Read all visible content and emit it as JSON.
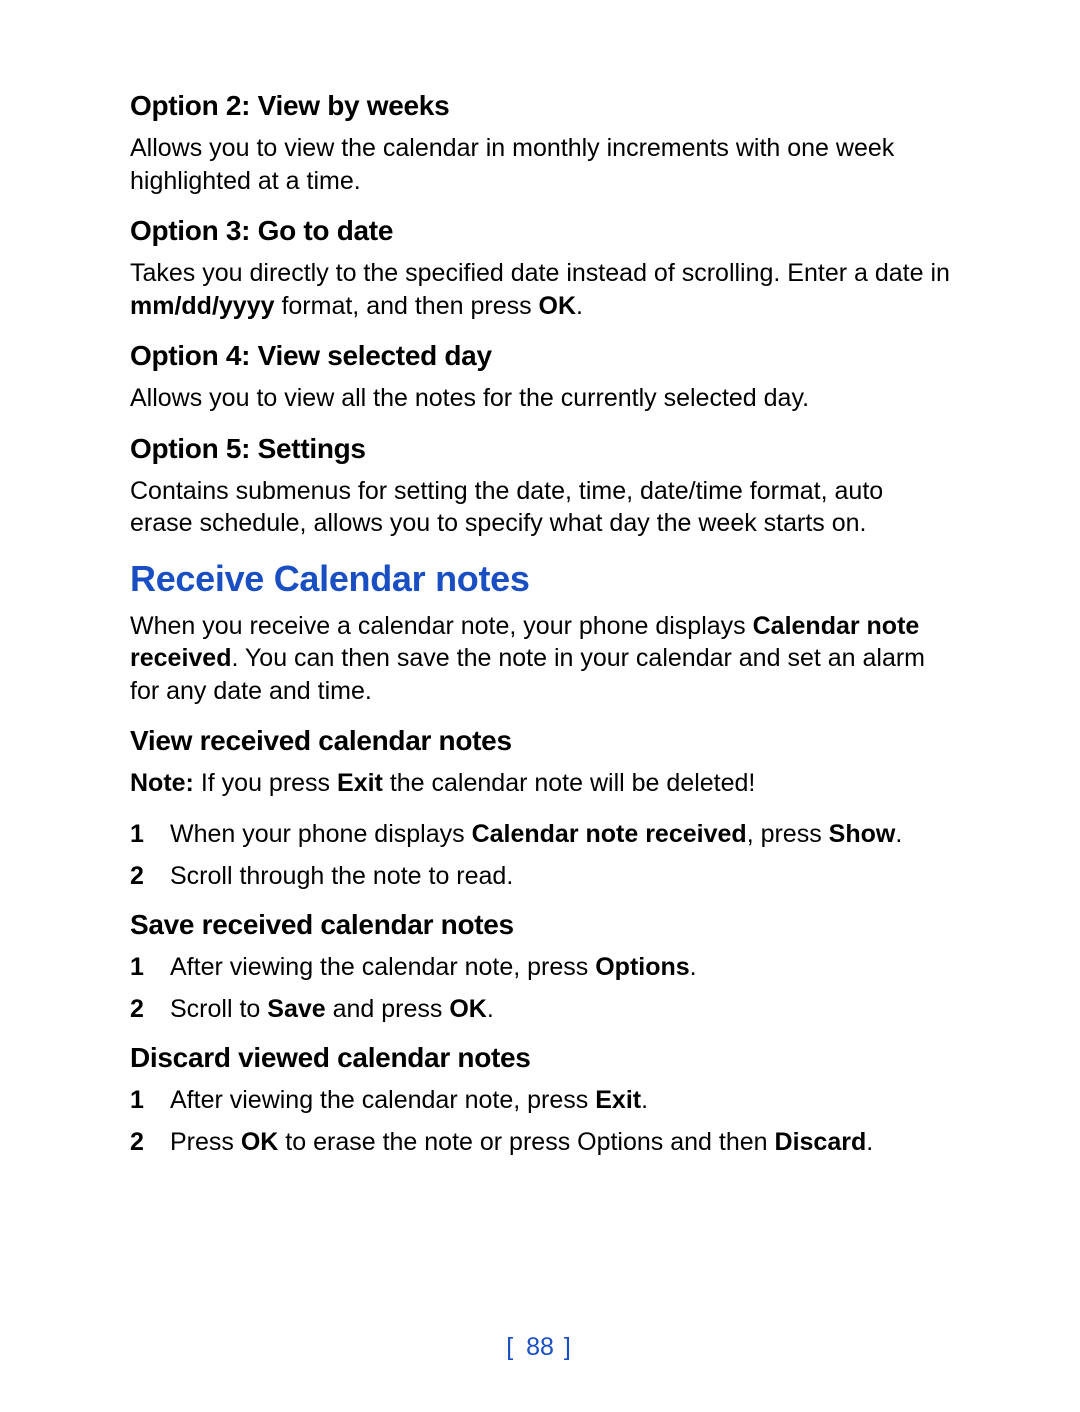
{
  "option2": {
    "heading": "Option 2: View by weeks",
    "body": "Allows you to view the calendar in monthly increments with one week highlighted at a time."
  },
  "option3": {
    "heading": "Option 3: Go to date",
    "body_pre": "Takes you directly to the specified date instead of scrolling. Enter a date in ",
    "body_bold1": "mm/dd/yyyy",
    "body_mid": " format, and then press ",
    "body_bold2": "OK",
    "body_post": "."
  },
  "option4": {
    "heading": "Option 4: View selected day",
    "body": "Allows you to view all the notes for the currently selected day."
  },
  "option5": {
    "heading": "Option 5: Settings",
    "body": "Contains submenus for setting the date, time, date/time format, auto erase schedule, allows you to specify what day the week starts on."
  },
  "receive": {
    "heading": "Receive Calendar notes",
    "body_pre": "When you receive a calendar note, your phone displays ",
    "body_bold1": "Calendar note received",
    "body_post": ". You can then save the note in your calendar and set an alarm for any date and time."
  },
  "view_notes": {
    "heading": "View received calendar notes",
    "note_bold": "Note:",
    "note_pre": "  If you press ",
    "note_bold2": "Exit",
    "note_post": " the calendar note will be deleted!",
    "step1_num": "1",
    "step1_pre": "When your phone displays ",
    "step1_bold1": "Calendar note received",
    "step1_mid": ", press ",
    "step1_bold2": "Show",
    "step1_post": ".",
    "step2_num": "2",
    "step2": "Scroll through the note to read."
  },
  "save_notes": {
    "heading": "Save received calendar notes",
    "step1_num": "1",
    "step1_pre": "After viewing the calendar note, press ",
    "step1_bold": "Options",
    "step1_post": ".",
    "step2_num": "2",
    "step2_pre": "Scroll to ",
    "step2_bold1": "Save",
    "step2_mid": " and press ",
    "step2_bold2": "OK",
    "step2_post": "."
  },
  "discard_notes": {
    "heading": "Discard viewed calendar notes",
    "step1_num": "1",
    "step1_pre": "After viewing the calendar note, press ",
    "step1_bold": "Exit",
    "step1_post": ".",
    "step2_num": "2",
    "step2_pre": "Press ",
    "step2_bold1": "OK",
    "step2_mid": " to erase the note or press Options and then ",
    "step2_bold2": "Discard",
    "step2_post": "."
  },
  "page": {
    "left": "[ ",
    "num": "88",
    "right": " ]"
  }
}
